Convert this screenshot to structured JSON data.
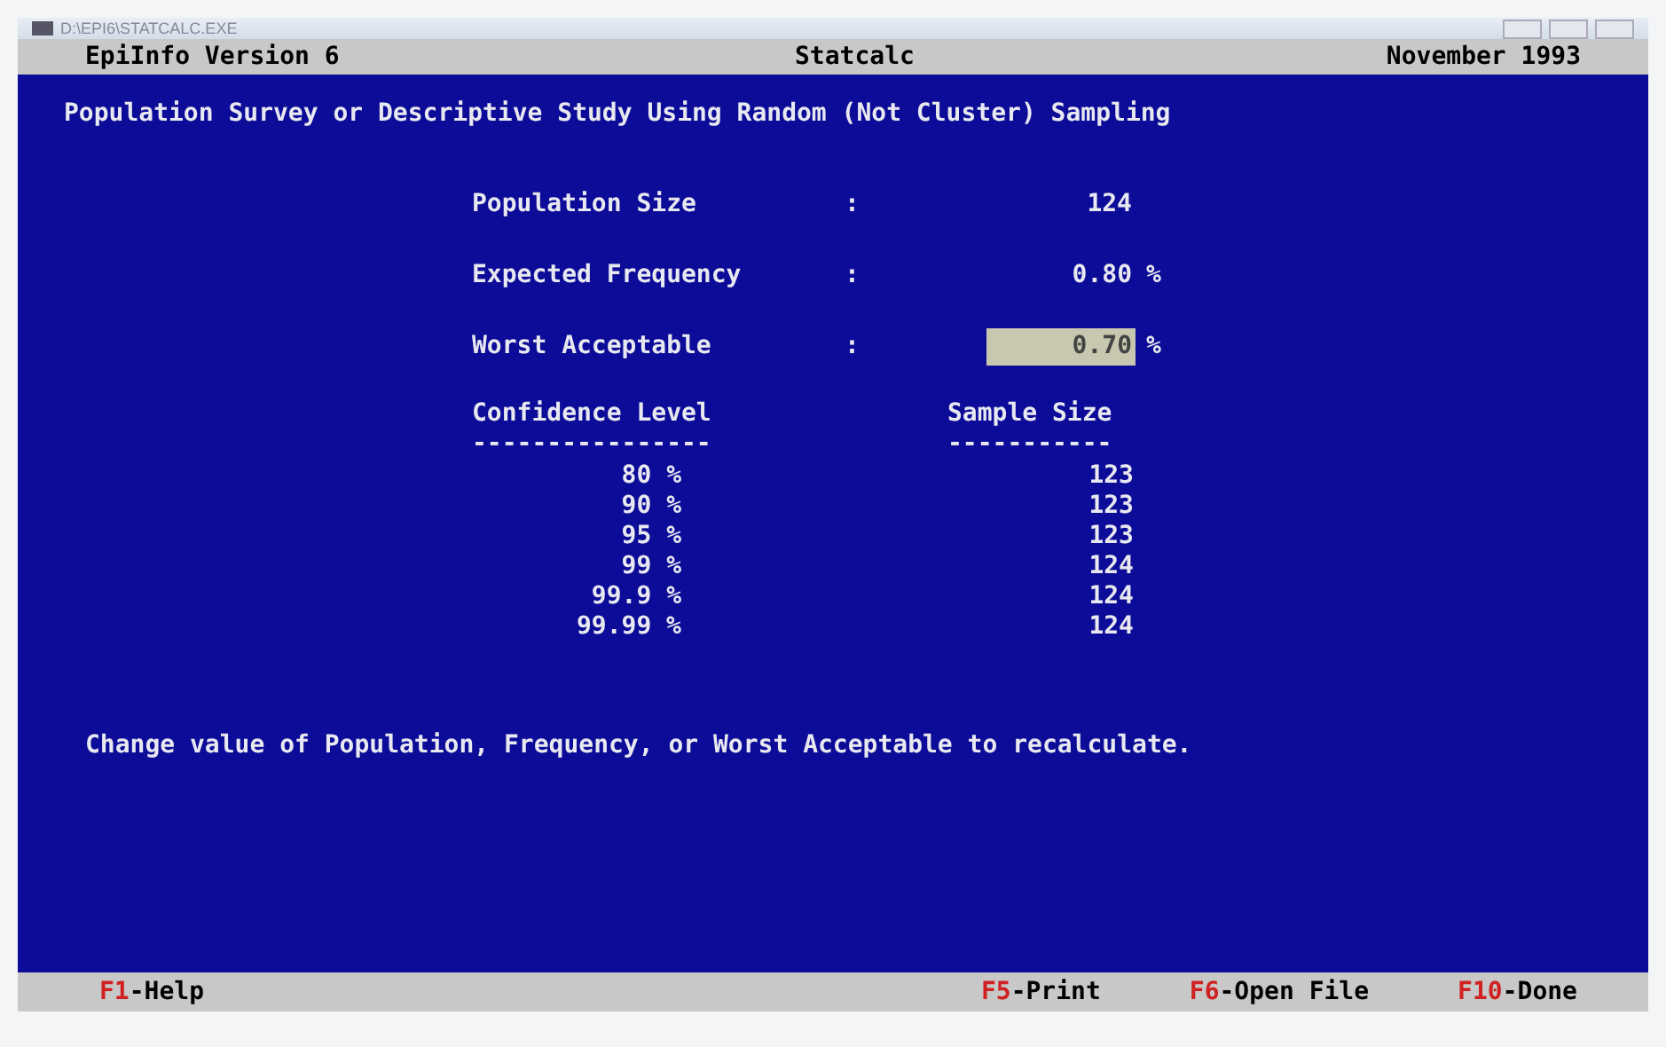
{
  "window": {
    "title": "D:\\EPI6\\STATCALC.EXE"
  },
  "header": {
    "left": "EpiInfo Version 6",
    "center": "Statcalc",
    "right": "November 1993"
  },
  "heading": "Population Survey or Descriptive Study Using Random (Not Cluster) Sampling",
  "fields": [
    {
      "label": "Population Size",
      "separator": ":",
      "value": "124",
      "selected": false
    },
    {
      "label": "Expected Frequency",
      "separator": ":",
      "value": "0.80",
      "unit": "%",
      "selected": false
    },
    {
      "label": "Worst Acceptable",
      "separator": ":",
      "value": "0.70",
      "unit": "%",
      "selected": true
    }
  ],
  "table": {
    "columns": [
      "Confidence Level",
      "Sample Size"
    ],
    "rules": [
      "----------------",
      "-----------"
    ],
    "rows": [
      [
        "80 %",
        "123"
      ],
      [
        "90 %",
        "123"
      ],
      [
        "95 %",
        "123"
      ],
      [
        "99 %",
        "124"
      ],
      [
        "99.9 %",
        "124"
      ],
      [
        "99.99 %",
        "124"
      ]
    ]
  },
  "hint": "Change value of Population, Frequency, or Worst Acceptable to recalculate.",
  "keys": [
    {
      "key": "F1",
      "label": "-Help"
    },
    {
      "key": "F5",
      "label": "-Print"
    },
    {
      "key": "F6",
      "label": "-Open File"
    },
    {
      "key": "F10",
      "label": "-Done"
    }
  ]
}
